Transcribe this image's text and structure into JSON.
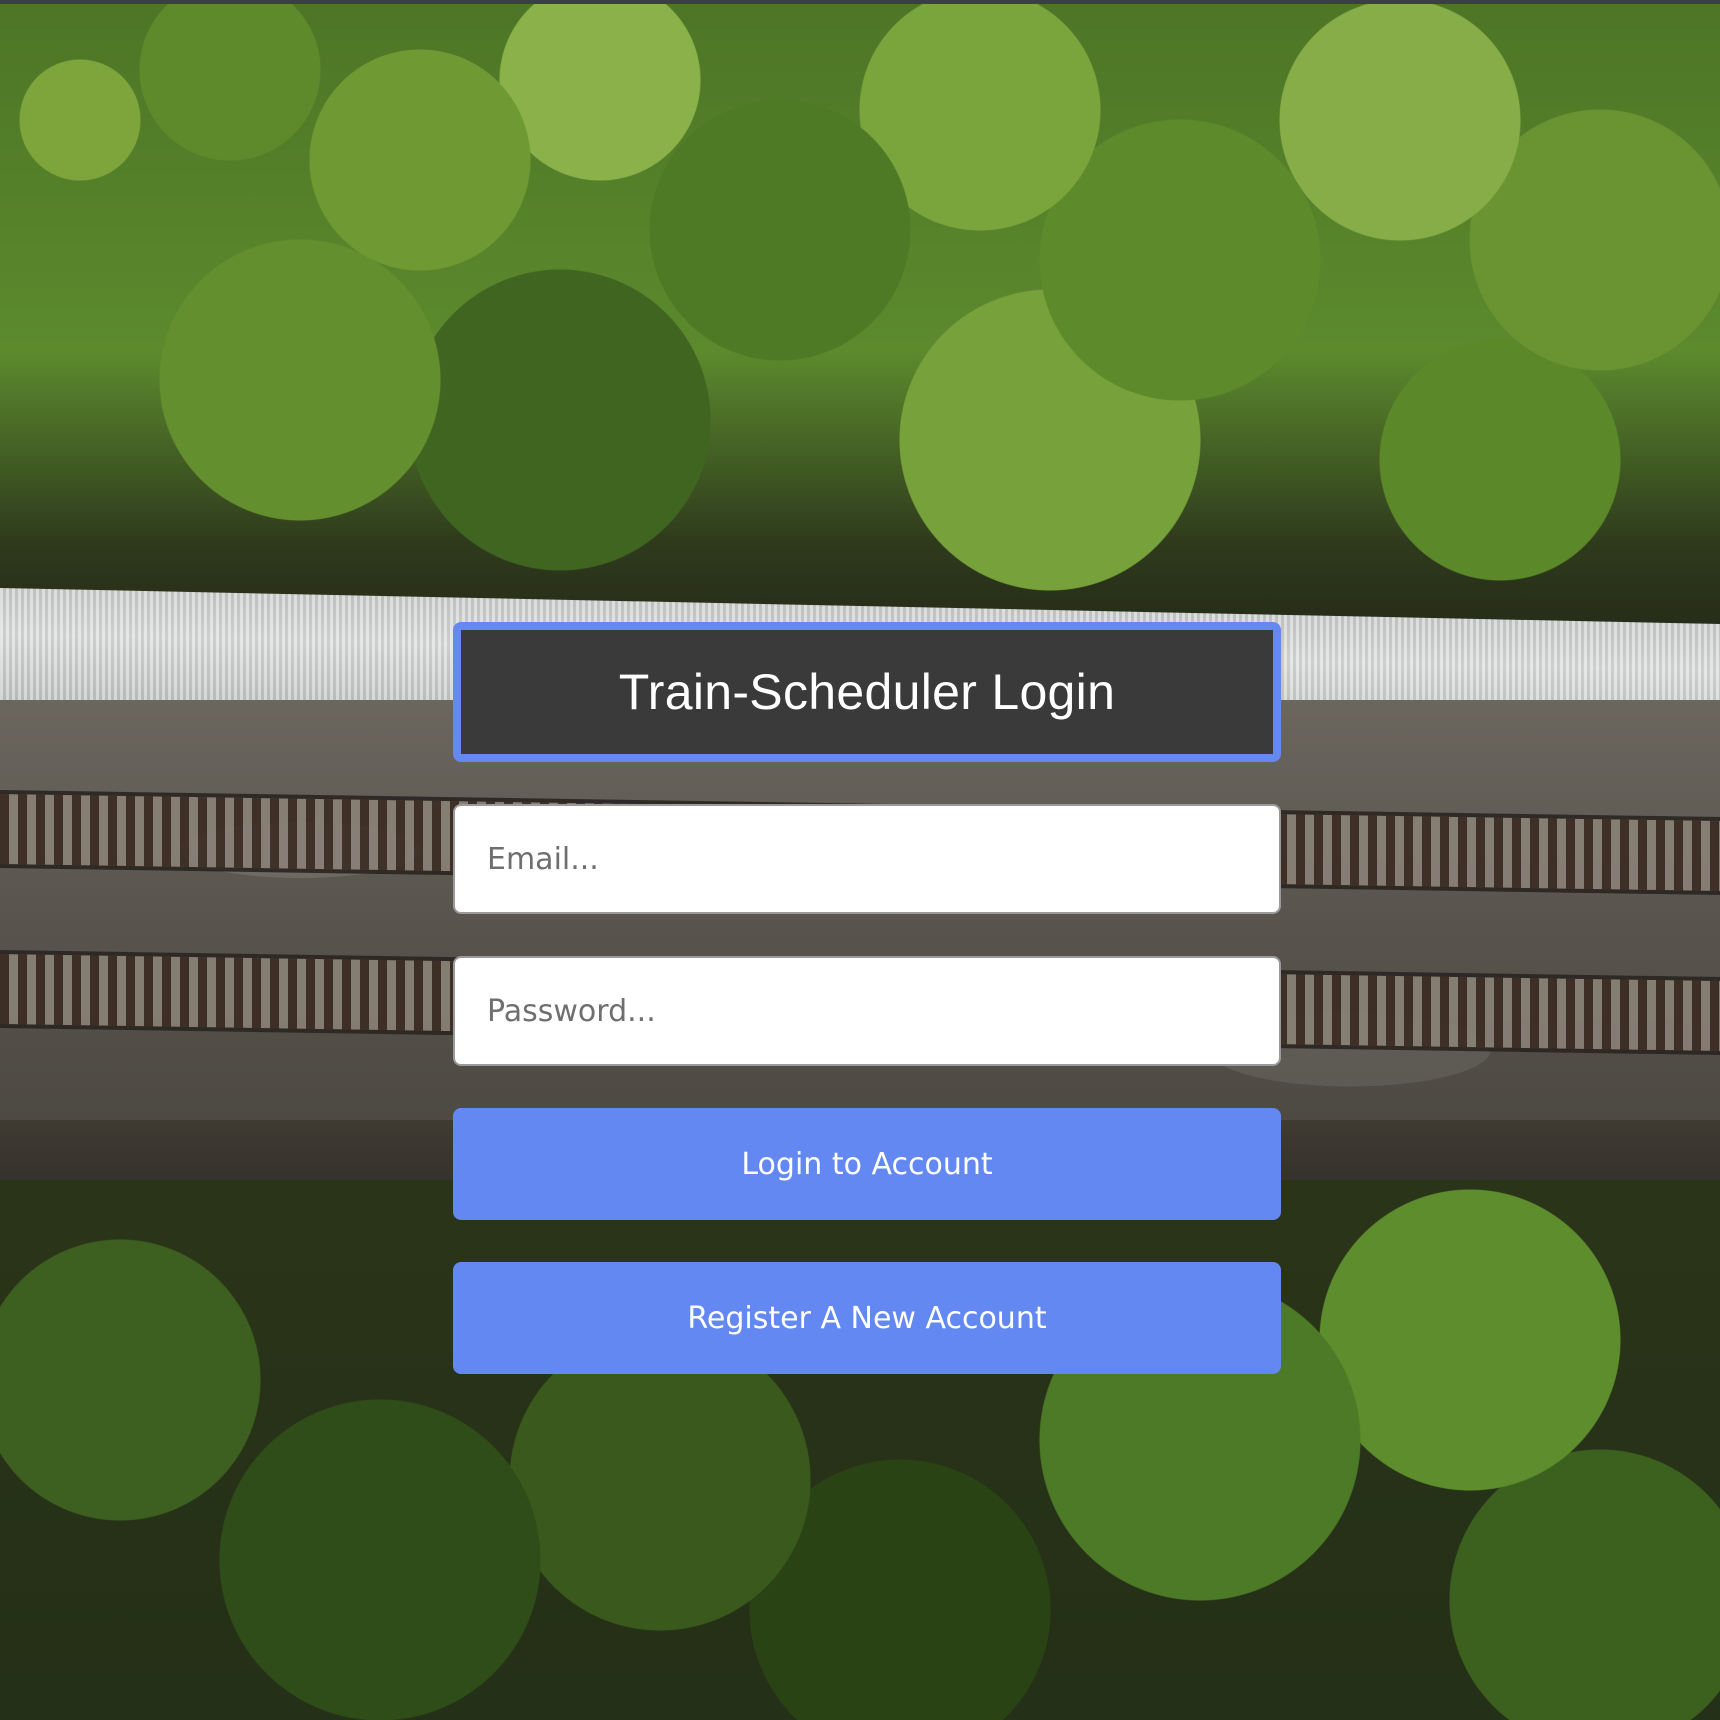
{
  "login": {
    "title": "Train-Scheduler Login",
    "email_placeholder": "Email...",
    "email_value": "",
    "password_placeholder": "Password...",
    "password_value": "",
    "login_button_label": "Login to Account",
    "register_button_label": "Register A New Account"
  },
  "colors": {
    "accent": "#6388f1",
    "title_background": "#3a3a3b",
    "title_border": "#6589f0",
    "button_text": "#ffffff"
  }
}
